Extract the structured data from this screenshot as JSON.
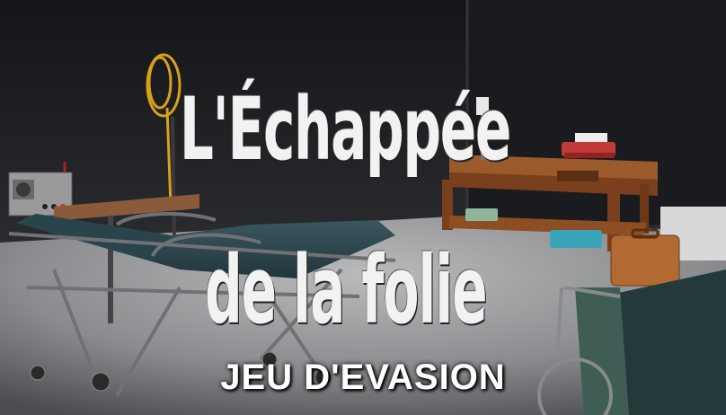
{
  "poster": {
    "title_line1": "L'Échappée",
    "title_line2": "de la folie",
    "subtitle": "JEU D'EVASION"
  },
  "colors": {
    "wall": "#1e1f22",
    "floor": "#8f9093",
    "wood": "#8a4a24",
    "mattress": "#2f4a52",
    "title_text": "#f2f2f2"
  }
}
